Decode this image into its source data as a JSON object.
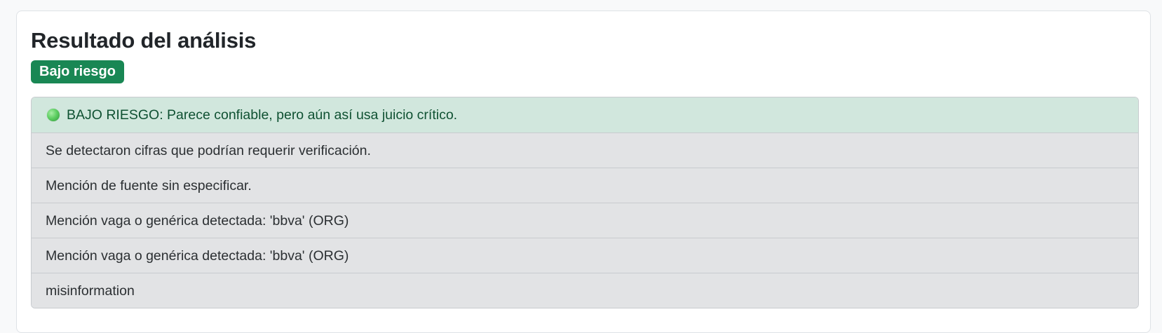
{
  "result": {
    "title": "Resultado del análisis",
    "badge_label": "Bajo riesgo",
    "status_icon": "green-circle-icon",
    "colors": {
      "badge": "#198754",
      "success_bg": "#d1e7dd",
      "success_text": "#0f5132",
      "item_bg": "#e2e3e5"
    },
    "summary": "BAJO RIESGO: Parece confiable, pero aún así usa juicio crítico.",
    "findings": [
      "Se detectaron cifras que podrían requerir verificación.",
      "Mención de fuente sin especificar.",
      "Mención vaga o genérica detectada: 'bbva' (ORG)",
      "Mención vaga o genérica detectada: 'bbva' (ORG)",
      "misinformation"
    ]
  }
}
